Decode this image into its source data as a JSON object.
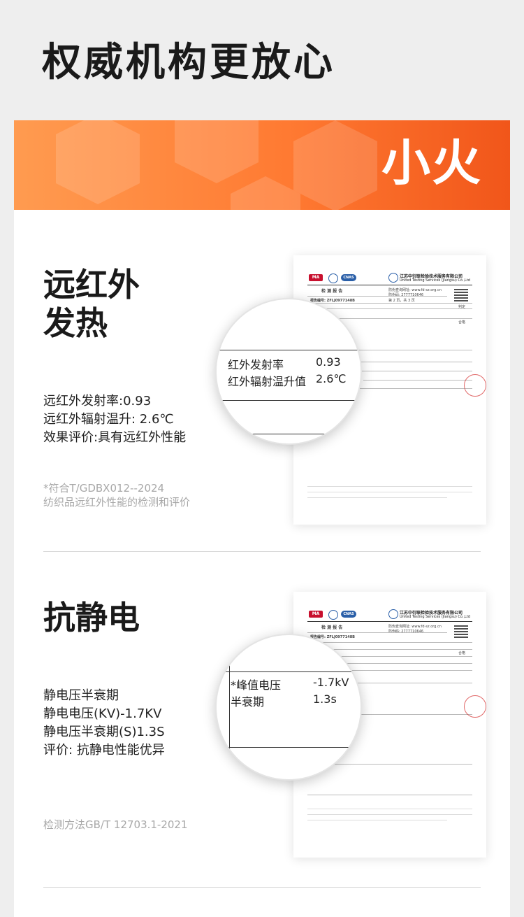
{
  "page": {
    "title": "权威机构更放心"
  },
  "banner": {
    "brand": "小火"
  },
  "sections": [
    {
      "title_line1": "远红外",
      "title_line2": "发热",
      "info": [
        "远红外发射率:0.93",
        "远红外辐射温升: 2.6℃",
        "效果评价:具有远红外性能"
      ],
      "note": [
        "*符合T/GDBX012--2024",
        "纺织品远红外性能的检测和评价"
      ],
      "magnifier": [
        {
          "label": "红外发射率",
          "value": "0.93"
        },
        {
          "label": "红外辐射温升值",
          "value": "2.6℃"
        }
      ]
    },
    {
      "title_line1": "抗静电",
      "info": [
        "静电压半衰期",
        "静电电压(KV)-1.7KV",
        "静电压半衰期(S)1.3S",
        "评价: 抗静电性能优异"
      ],
      "note": [
        "检测方法GB/T 12703.1-2021"
      ],
      "magnifier": [
        {
          "label": "*峰值电压",
          "value": "-1.7kV"
        },
        {
          "label": "半衰期",
          "value": "1.3s"
        }
      ]
    }
  ],
  "report": {
    "org_cn": "江苏中衍联检验技术服务有限公司",
    "org_en": "United Testing Services (Jiangsu) Co.,Ltd",
    "heading": "检 测 报 告",
    "report_no": "报告编号: ZFLJ0977148B",
    "website": "防伪查询网址: www.fd-sz.org.cn",
    "code": "防伪码: 2777710646",
    "page1": "第 2 页，共 3 页",
    "conclusion_label": "判定",
    "result_label": "合格"
  }
}
